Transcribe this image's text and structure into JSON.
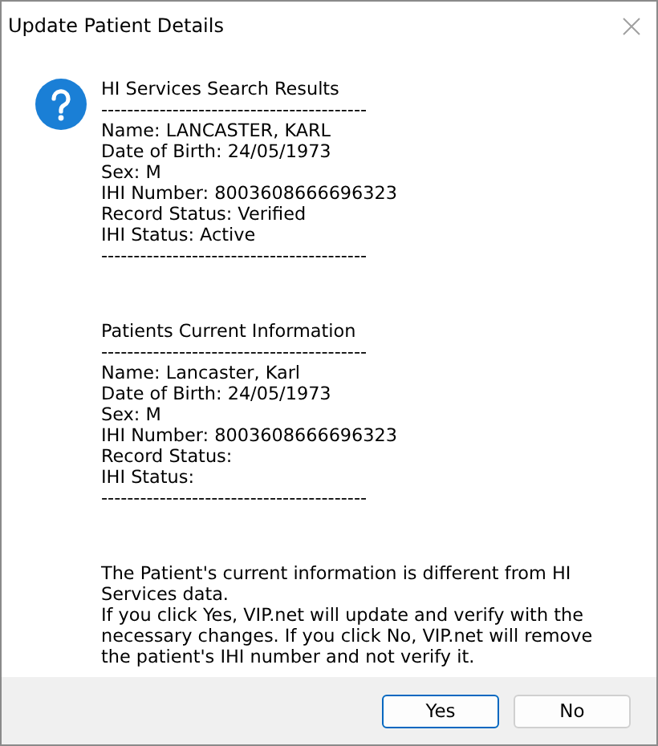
{
  "window": {
    "title": "Update Patient Details"
  },
  "blocks": [
    {
      "heading": "HI Services Search Results",
      "rule": "-----------------------------------------",
      "lines": [
        "Name: LANCASTER, KARL",
        "Date of Birth: 24/05/1973",
        "Sex: M",
        "IHI Number: 8003608666696323",
        "Record Status: Verified",
        "IHI Status: Active"
      ],
      "end_rule": "-----------------------------------------"
    },
    {
      "heading": "Patients Current Information",
      "rule": "-----------------------------------------",
      "lines": [
        "Name: Lancaster, Karl",
        "Date of Birth: 24/05/1973",
        "Sex: M",
        "IHI Number: 8003608666696323",
        "Record Status:",
        "IHI Status:"
      ],
      "end_rule": "-----------------------------------------"
    }
  ],
  "message": [
    "The Patient's current information is different from HI Services data.",
    "If you click Yes, VIP.net will update and verify with the necessary changes. If you click No, VIP.net will remove the patient's IHI number and not verify it."
  ],
  "buttons": [
    {
      "label": "Yes",
      "default": true
    },
    {
      "label": "No",
      "default": false
    }
  ]
}
